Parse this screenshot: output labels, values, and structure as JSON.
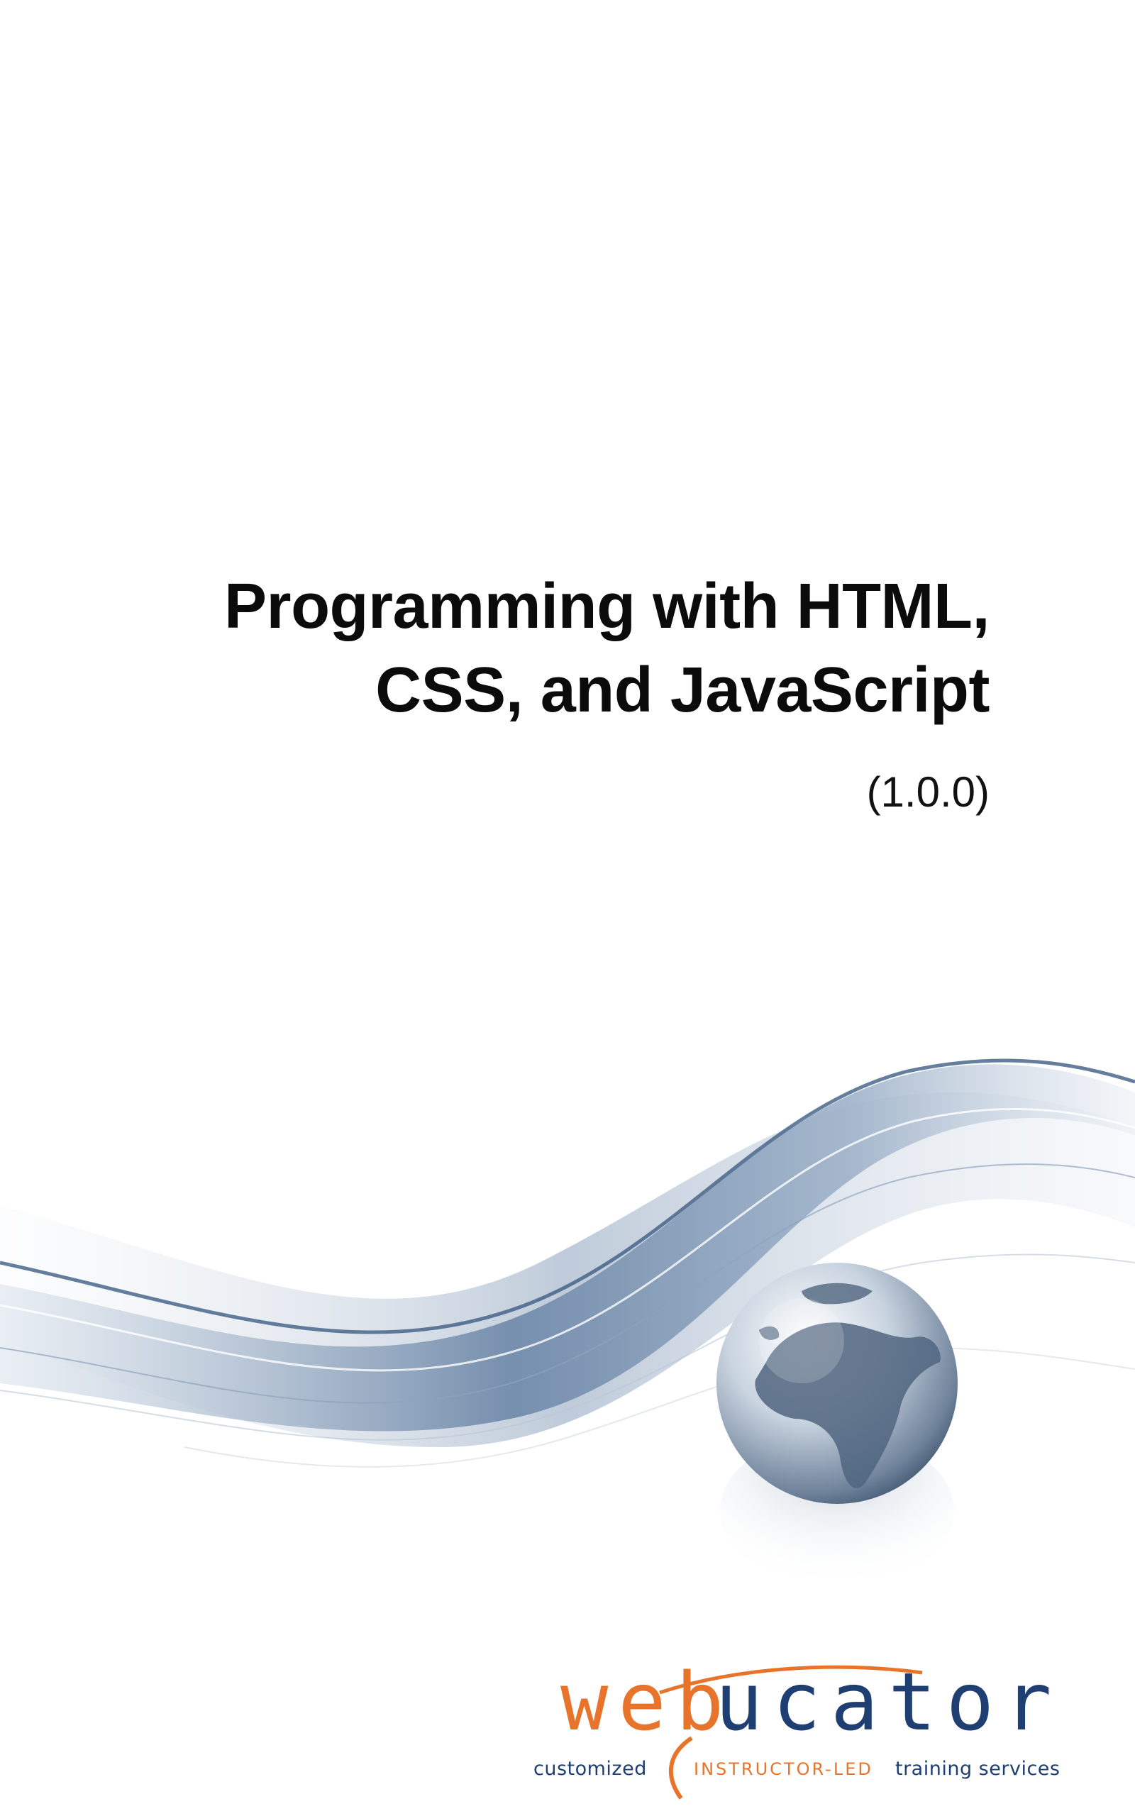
{
  "cover": {
    "title_lines": [
      "Programming with HTML,",
      "CSS, and JavaScript"
    ],
    "version": "(1.0.0)"
  },
  "logo": {
    "word_part1": "web",
    "word_part2": "ucator",
    "tagline_left": "customized",
    "tagline_mid": "INSTRUCTOR-LED",
    "tagline_right": "training services",
    "colors": {
      "orange": "#e8742c",
      "navy": "#1f3f73"
    }
  },
  "art": {
    "wave_colors": [
      "#4a6a8f",
      "#8fa6c0",
      "#d9e2ec"
    ],
    "globe_icon": "globe-icon"
  }
}
